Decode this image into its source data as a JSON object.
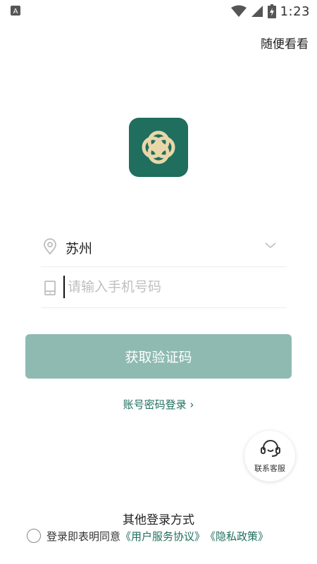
{
  "status_bar": {
    "time": "1:23",
    "app_icon": "a-icon",
    "wifi_icon": "wifi-icon",
    "signal_icon": "signal-icon",
    "battery_icon": "battery-charging-icon"
  },
  "header": {
    "browse_label": "随便看看"
  },
  "logo": {
    "icon": "app-logo-icon",
    "color": "#1f6e5e"
  },
  "form": {
    "city": {
      "icon": "location-pin-icon",
      "value": "苏州",
      "dropdown_icon": "chevron-down-icon"
    },
    "phone": {
      "icon": "phone-icon",
      "placeholder": "请输入手机号码",
      "value": ""
    },
    "submit_label": "获取验证码"
  },
  "links": {
    "password_login": "账号密码登录 ›"
  },
  "service": {
    "icon": "headset-icon",
    "label": "联系客服"
  },
  "other_login": {
    "label": "其他登录方式"
  },
  "agreement": {
    "prefix": "登录即表明同意",
    "user_agreement": "《用户服务协议》",
    "privacy_policy": "《隐私政策》",
    "checked": false
  },
  "colors": {
    "accent": "#1f6e5e",
    "button_disabled": "#8fbab2"
  }
}
